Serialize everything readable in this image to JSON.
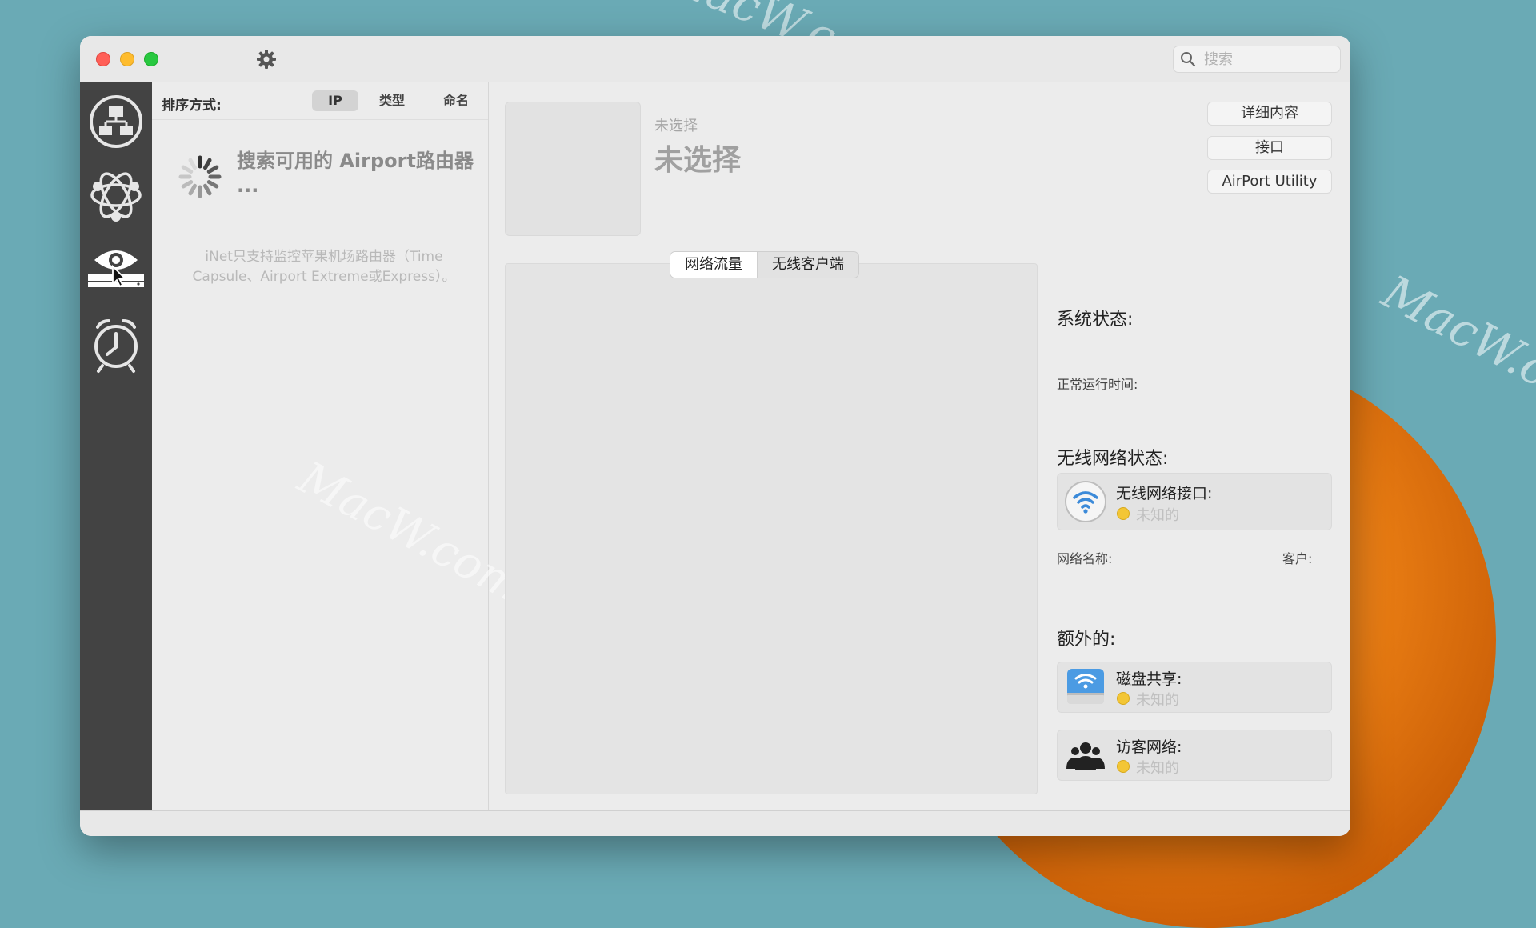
{
  "watermarks": [
    "MacW.com",
    "MacW.com",
    "MacW.c"
  ],
  "search": {
    "placeholder": "搜索"
  },
  "rail": {
    "items": [
      "network-icon",
      "orbit-network-icon",
      "monitor-eye-icon",
      "alarm-clock-icon"
    ]
  },
  "list": {
    "sort_label": "排序方式:",
    "sort_options": [
      "IP",
      "类型",
      "命名"
    ],
    "active_sort": "IP",
    "searching_title": "搜索可用的 Airport路由器 ...",
    "hint": "iNet只支持监控苹果机场路由器（Time Capsule、Airport Extreme或Express）。"
  },
  "detail": {
    "unselected_small": "未选择",
    "unselected_big": "未选择",
    "buttons": [
      "详细内容",
      "接口",
      "AirPort Utility"
    ],
    "tabs": [
      "网络流量",
      "无线客户端"
    ],
    "active_tab": "网络流量"
  },
  "info": {
    "system_status": "系统状态:",
    "uptime_label": "正常运行时间:",
    "wireless_status": "无线网络状态:",
    "wireless_interface": "无线网络接口:",
    "wireless_state": "未知的",
    "network_name_label": "网络名称:",
    "clients_label": "客户:",
    "extra": "额外的:",
    "disk_sharing": "磁盘共享:",
    "disk_state": "未知的",
    "guest_network": "访客网络:",
    "guest_state": "未知的"
  },
  "colors": {
    "desktop": "#6aaab5",
    "rail": "#434343",
    "status_dot": "#f3c635"
  }
}
